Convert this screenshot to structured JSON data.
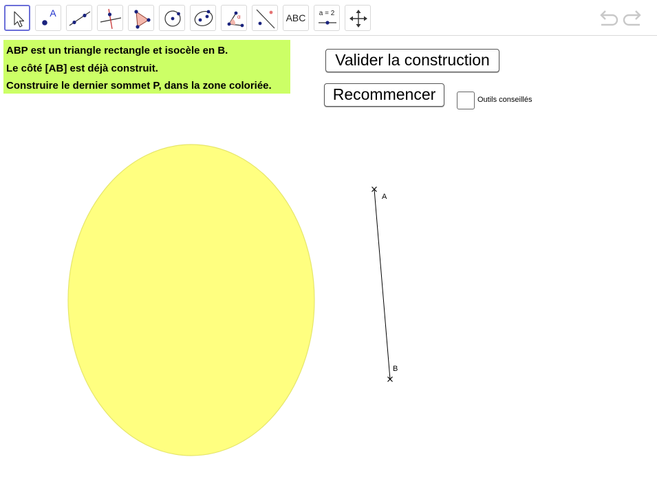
{
  "toolbar": {
    "tools": [
      {
        "name": "move-tool",
        "icon": "cursor-arrow-icon"
      },
      {
        "name": "point-tool",
        "icon": "point-icon",
        "label": "A"
      },
      {
        "name": "line-tool",
        "icon": "line-through-points-icon"
      },
      {
        "name": "perpendicular-tool",
        "icon": "perpendicular-line-icon"
      },
      {
        "name": "polygon-tool",
        "icon": "polygon-icon"
      },
      {
        "name": "circle-tool",
        "icon": "circle-center-point-icon"
      },
      {
        "name": "conic-tool",
        "icon": "ellipse-icon"
      },
      {
        "name": "angle-tool",
        "icon": "angle-icon",
        "label": "α"
      },
      {
        "name": "reflect-tool",
        "icon": "reflect-about-line-icon"
      },
      {
        "name": "text-tool",
        "icon": "text-icon",
        "label": "ABC"
      },
      {
        "name": "slider-tool",
        "icon": "slider-icon",
        "label": "a = 2"
      },
      {
        "name": "move-view-tool",
        "icon": "move-graphics-view-icon"
      }
    ],
    "undo_icon": "undo-icon",
    "redo_icon": "redo-icon"
  },
  "instructions": {
    "line1": "ABP est un triangle rectangle et isocèle en B.",
    "line2": "Le côté [AB] est déjà construit.",
    "line3": "Construire le dernier sommet P, dans la zone coloriée.",
    "background": "#ccff66"
  },
  "buttons": {
    "validate": "Valider la construction",
    "restart": "Recommencer"
  },
  "checkbox": {
    "label": "Outils conseillés",
    "checked": false
  },
  "figure": {
    "zone_color": "#ffff80",
    "zone_border": "#e6e66a",
    "point_a_label": "A",
    "point_b_label": "B"
  }
}
